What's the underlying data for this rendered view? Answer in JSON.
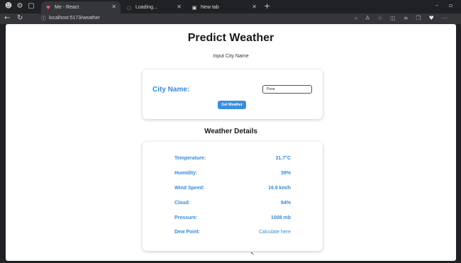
{
  "browser": {
    "tabs": [
      {
        "title": "Me - React",
        "active": true
      },
      {
        "title": "Loading...",
        "active": false
      },
      {
        "title": "New tab",
        "active": false
      }
    ],
    "url": "localhost:5173/weather",
    "tab_close": "✕",
    "new_tab": "+",
    "minimize": "–",
    "close_window": "▫"
  },
  "page": {
    "title": "Predict Weather",
    "subtitle": "Input City Name",
    "city_label": "City Name:",
    "city_value": "Pune",
    "button_label": "Get Weather",
    "details_title": "Weather Details",
    "details": [
      {
        "label": "Temperature:",
        "value": "31.7°C"
      },
      {
        "label": "Humidity:",
        "value": "39%"
      },
      {
        "label": "Wind Speed:",
        "value": "16.9 km/h"
      },
      {
        "label": "Cloud:",
        "value": "84%"
      },
      {
        "label": "Pressure:",
        "value": "1008 mb"
      },
      {
        "label": "Dew Point:",
        "value": "Calculate here"
      }
    ]
  },
  "colors": {
    "accent": "#3a8ad8",
    "button": "#3b8fdc",
    "chrome_dark": "#202124",
    "chrome_toolbar": "#35363a"
  }
}
